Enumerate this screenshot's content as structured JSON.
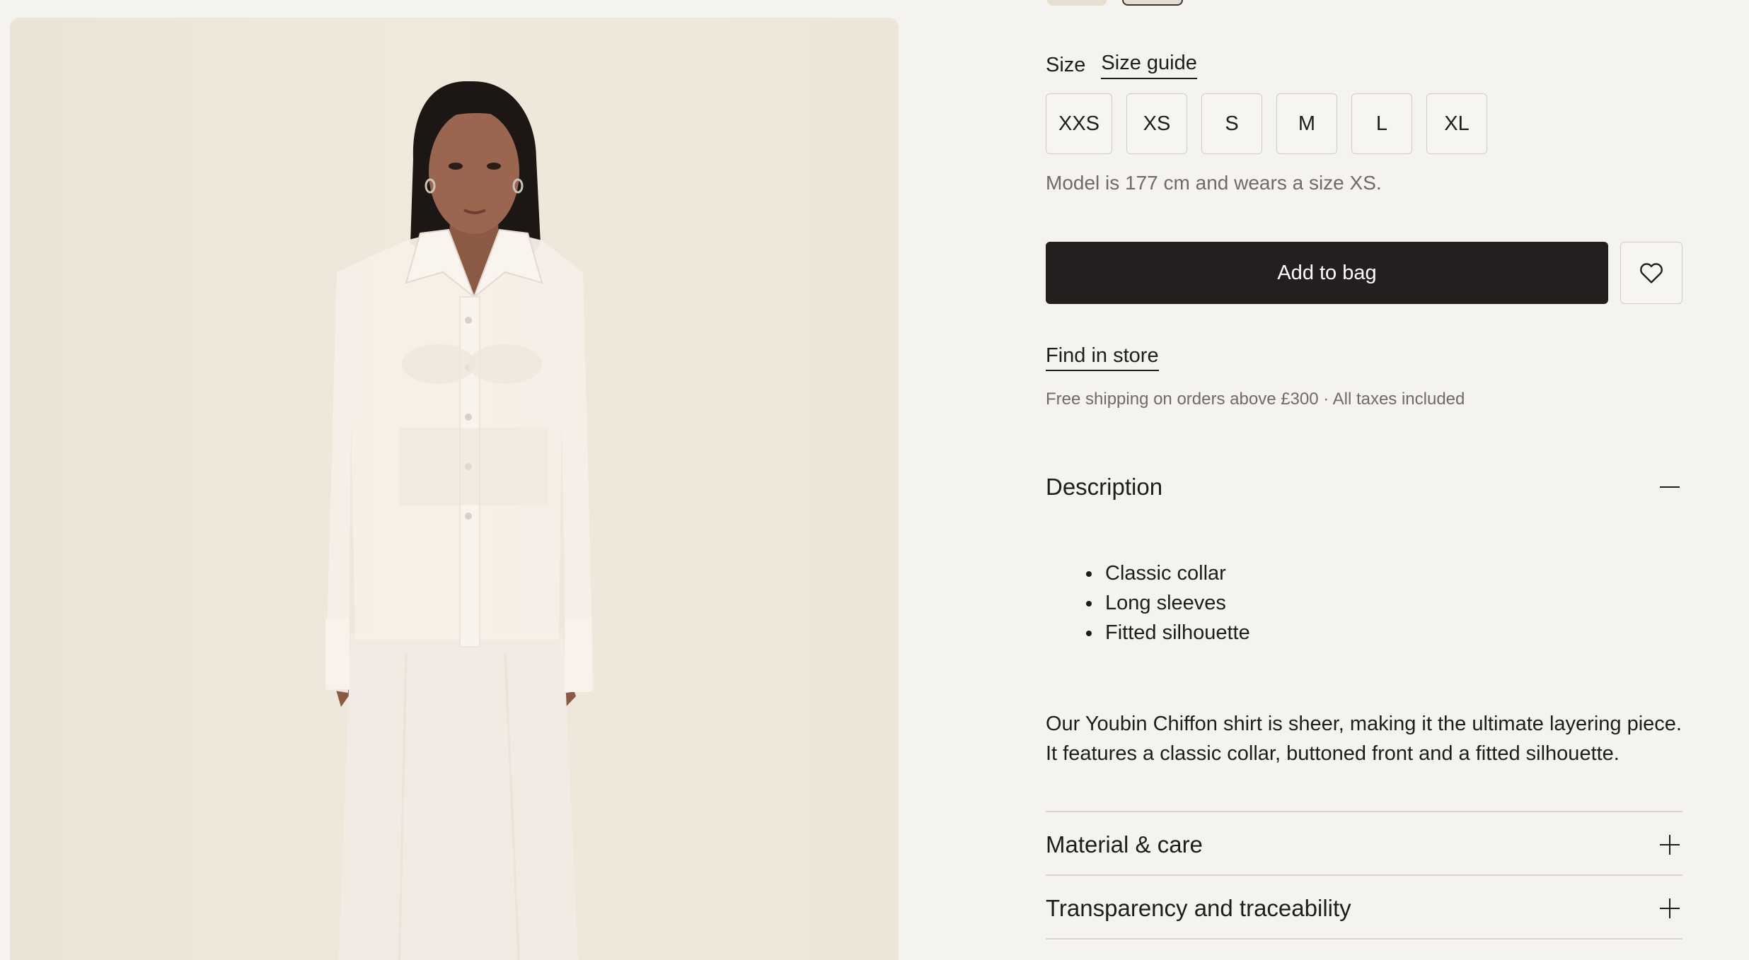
{
  "product": {
    "size_label": "Size",
    "size_guide_label": "Size guide",
    "sizes": [
      "XXS",
      "XS",
      "S",
      "M",
      "L",
      "XL"
    ],
    "model_note": "Model is 177 cm and wears a size XS.",
    "add_to_bag_label": "Add to bag",
    "wishlist_icon": "heart-icon",
    "find_in_store_label": "Find in store",
    "shipping_note": "Free shipping on orders above £300 · All taxes included"
  },
  "accordion": {
    "description": {
      "title": "Description",
      "icon": "minus-icon",
      "bullets": [
        "Classic collar",
        "Long sleeves",
        "Fitted silhouette"
      ],
      "paragraph_line1": "Our Youbin Chiffon shirt is sheer, making it the ultimate layering piece.",
      "paragraph_line2": "It features a classic collar, buttoned front and a fitted silhouette."
    },
    "material": {
      "title": "Material & care",
      "icon": "plus-icon"
    },
    "traceability": {
      "title": "Transparency and traceability",
      "icon": "plus-icon"
    }
  },
  "colors": {
    "button_dark": "#231f1e",
    "background": "#f4f3f0",
    "image_background": "#ede6d8",
    "garment": "#f4ede4"
  }
}
